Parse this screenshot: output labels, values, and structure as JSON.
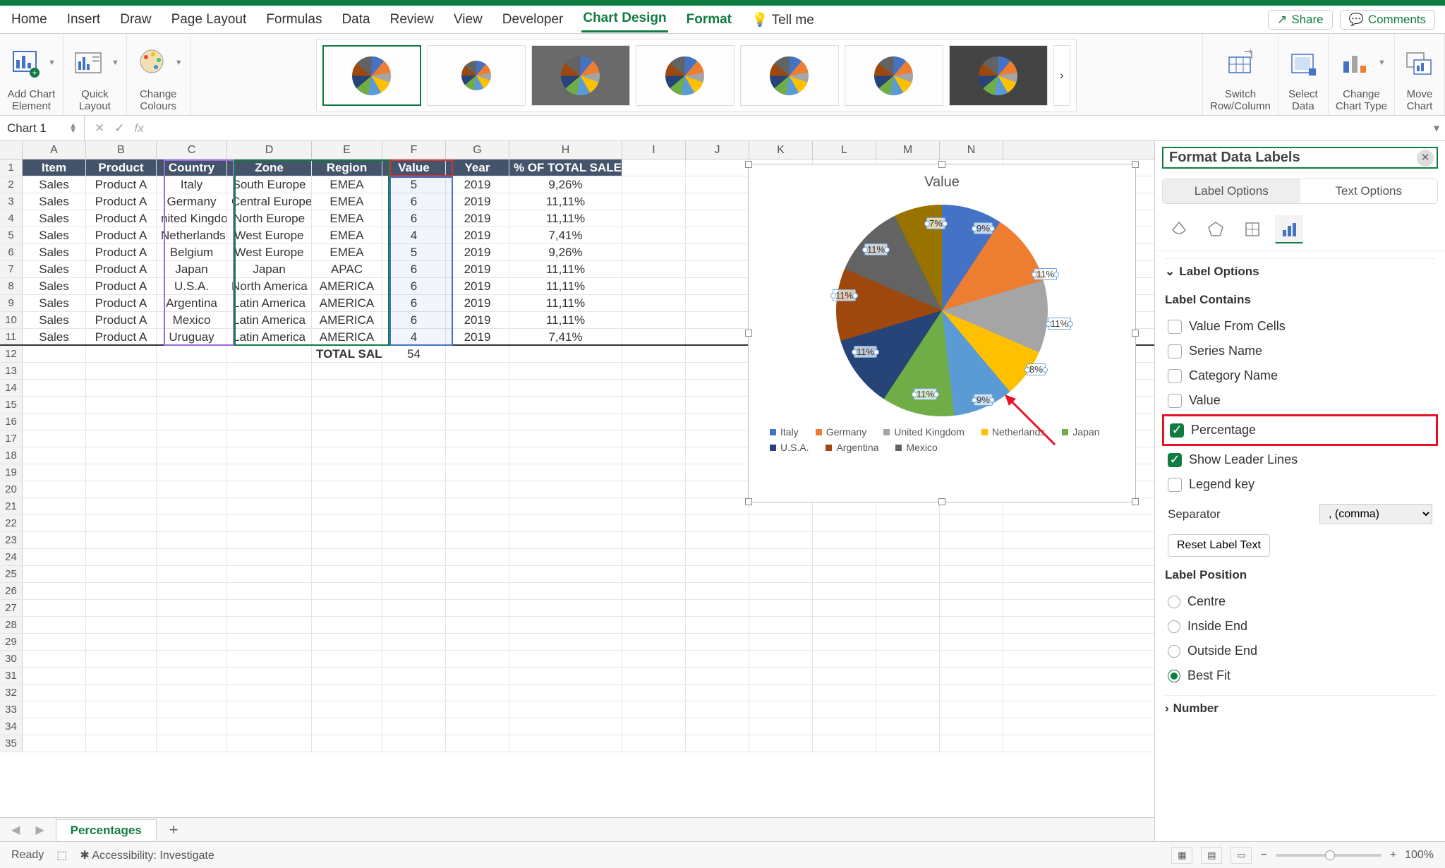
{
  "ribbon": {
    "tabs": [
      "Home",
      "Insert",
      "Draw",
      "Page Layout",
      "Formulas",
      "Data",
      "Review",
      "View",
      "Developer",
      "Chart Design",
      "Format"
    ],
    "active_tab": "Chart Design",
    "tell_me": "Tell me",
    "share": "Share",
    "comments": "Comments",
    "groups": {
      "add_chart_element": "Add Chart\nElement",
      "quick_layout": "Quick\nLayout",
      "change_colours": "Change\nColours",
      "switch": "Switch\nRow/Column",
      "select_data": "Select\nData",
      "change_type": "Change\nChart Type",
      "move_chart": "Move\nChart"
    }
  },
  "name_box": "Chart 1",
  "fx_placeholder": "fx",
  "columns": [
    "A",
    "B",
    "C",
    "D",
    "E",
    "F",
    "G",
    "H",
    "I",
    "J",
    "K",
    "L",
    "M",
    "N"
  ],
  "headers": [
    "Item",
    "Product",
    "Country",
    "Zone",
    "Region",
    "Value",
    "Year",
    "% OF TOTAL SALES"
  ],
  "rows": [
    {
      "item": "Sales",
      "product": "Product A",
      "country": "Italy",
      "zone": "South Europe",
      "region": "EMEA",
      "value": "5",
      "year": "2019",
      "pct": "9,26%"
    },
    {
      "item": "Sales",
      "product": "Product A",
      "country": "Germany",
      "zone": "Central Europe",
      "region": "EMEA",
      "value": "6",
      "year": "2019",
      "pct": "11,11%"
    },
    {
      "item": "Sales",
      "product": "Product A",
      "country": "nited Kingdo",
      "zone": "North Europe",
      "region": "EMEA",
      "value": "6",
      "year": "2019",
      "pct": "11,11%"
    },
    {
      "item": "Sales",
      "product": "Product A",
      "country": "Netherlands",
      "zone": "West Europe",
      "region": "EMEA",
      "value": "4",
      "year": "2019",
      "pct": "7,41%"
    },
    {
      "item": "Sales",
      "product": "Product A",
      "country": "Belgium",
      "zone": "West Europe",
      "region": "EMEA",
      "value": "5",
      "year": "2019",
      "pct": "9,26%"
    },
    {
      "item": "Sales",
      "product": "Product A",
      "country": "Japan",
      "zone": "Japan",
      "region": "APAC",
      "value": "6",
      "year": "2019",
      "pct": "11,11%"
    },
    {
      "item": "Sales",
      "product": "Product A",
      "country": "U.S.A.",
      "zone": "North America",
      "region": "AMERICA",
      "value": "6",
      "year": "2019",
      "pct": "11,11%"
    },
    {
      "item": "Sales",
      "product": "Product A",
      "country": "Argentina",
      "zone": "Latin America",
      "region": "AMERICA",
      "value": "6",
      "year": "2019",
      "pct": "11,11%"
    },
    {
      "item": "Sales",
      "product": "Product A",
      "country": "Mexico",
      "zone": "Latin America",
      "region": "AMERICA",
      "value": "6",
      "year": "2019",
      "pct": "11,11%"
    },
    {
      "item": "Sales",
      "product": "Product A",
      "country": "Uruguay",
      "zone": "Latin America",
      "region": "AMERICA",
      "value": "4",
      "year": "2019",
      "pct": "7,41%"
    }
  ],
  "total_label": "TOTAL SALES",
  "total_value": "54",
  "chart": {
    "title": "Value",
    "labels": [
      "9%",
      "11%",
      "11%",
      "8%",
      "9%",
      "11%",
      "11%",
      "11%",
      "11%",
      "7%"
    ],
    "legend": [
      {
        "name": "Italy",
        "color": "#4472C4"
      },
      {
        "name": "Germany",
        "color": "#ED7D31"
      },
      {
        "name": "United Kingdom",
        "color": "#A5A5A5"
      },
      {
        "name": "Netherlands",
        "color": "#FFC000"
      },
      {
        "name": "Japan",
        "color": "#70AD47"
      },
      {
        "name": "U.S.A.",
        "color": "#264478"
      },
      {
        "name": "Argentina",
        "color": "#9E480E"
      },
      {
        "name": "Mexico",
        "color": "#636363"
      }
    ]
  },
  "chart_data": {
    "type": "pie",
    "title": "Value",
    "categories": [
      "Italy",
      "Germany",
      "United Kingdom",
      "Netherlands",
      "Belgium",
      "Japan",
      "U.S.A.",
      "Argentina",
      "Mexico",
      "Uruguay"
    ],
    "values": [
      5,
      6,
      6,
      4,
      5,
      6,
      6,
      6,
      6,
      4
    ],
    "percentages": [
      "9%",
      "11%",
      "11%",
      "7%",
      "9%",
      "11%",
      "11%",
      "11%",
      "11%",
      "7%"
    ],
    "colors": [
      "#4472C4",
      "#ED7D31",
      "#A5A5A5",
      "#FFC000",
      "#5B9BD5",
      "#70AD47",
      "#264478",
      "#9E480E",
      "#636363",
      "#997300"
    ]
  },
  "pane": {
    "title": "Format Data Labels",
    "tab_label_options": "Label Options",
    "tab_text_options": "Text Options",
    "section_label_options": "Label Options",
    "label_contains": "Label Contains",
    "opts": {
      "value_from_cells": "Value From Cells",
      "series_name": "Series Name",
      "category_name": "Category Name",
      "value": "Value",
      "percentage": "Percentage",
      "leader_lines": "Show Leader Lines",
      "legend_key": "Legend key"
    },
    "separator_label": "Separator",
    "separator_value": ", (comma)",
    "reset": "Reset Label Text",
    "label_position": "Label Position",
    "positions": {
      "centre": "Centre",
      "inside_end": "Inside End",
      "outside_end": "Outside End",
      "best_fit": "Best Fit"
    },
    "number_section": "Number"
  },
  "sheet_tab": "Percentages",
  "status": {
    "ready": "Ready",
    "accessibility": "Accessibility: Investigate",
    "zoom": "100%"
  }
}
